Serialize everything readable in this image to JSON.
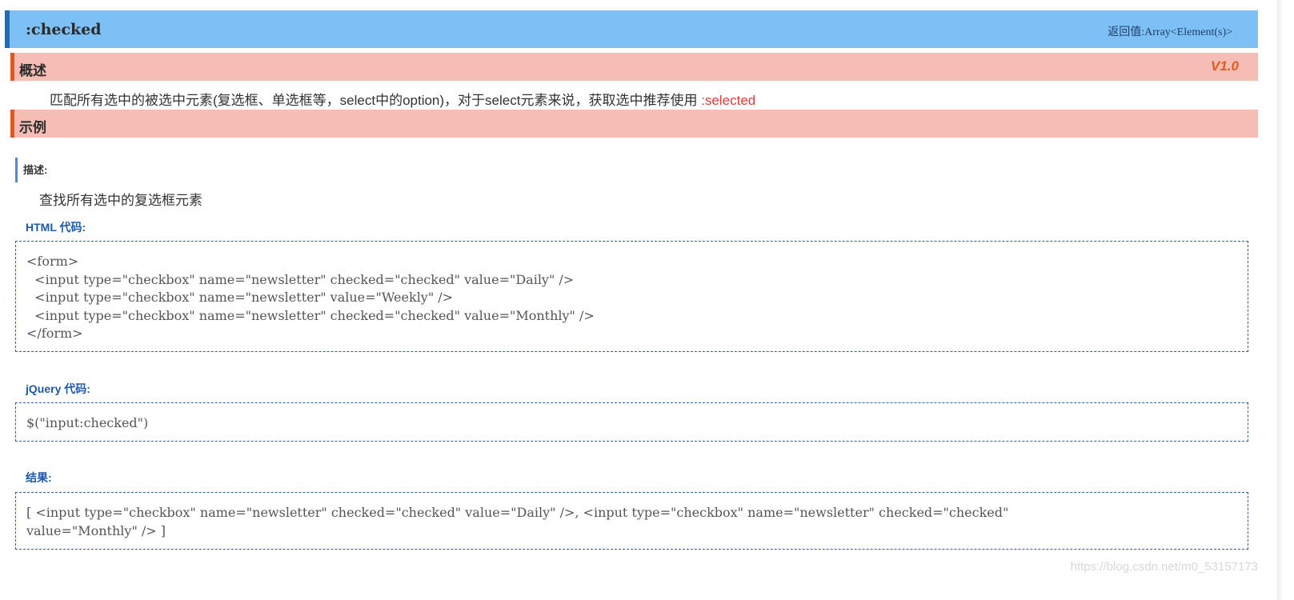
{
  "header": {
    "title": ":checked",
    "return_label": "返回值:Array<Element(s)>"
  },
  "overview": {
    "label": "概述",
    "version": "V1.0",
    "text": "匹配所有选中的被选中元素(复选框、单选框等，select中的option)，对于select元素来说，获取选中推荐使用 ",
    "highlight": ":selected"
  },
  "example": {
    "label": "示例",
    "desc_label": "描述:",
    "desc_text": "查找所有选中的复选框元素",
    "html_heading": "HTML 代码:",
    "html_code": "<form>\n  <input type=\"checkbox\" name=\"newsletter\" checked=\"checked\" value=\"Daily\" />\n  <input type=\"checkbox\" name=\"newsletter\" value=\"Weekly\" />\n  <input type=\"checkbox\" name=\"newsletter\" checked=\"checked\" value=\"Monthly\" />\n</form>",
    "jquery_heading": "jQuery 代码:",
    "jquery_code": "$(\"input:checked\")",
    "result_heading": "结果:",
    "result_code": "[ <input type=\"checkbox\" name=\"newsletter\" checked=\"checked\" value=\"Daily\" />, <input type=\"checkbox\" name=\"newsletter\" checked=\"checked\"\nvalue=\"Monthly\" /> ]"
  },
  "watermark": "https://blog.csdn.net/m0_53157173"
}
